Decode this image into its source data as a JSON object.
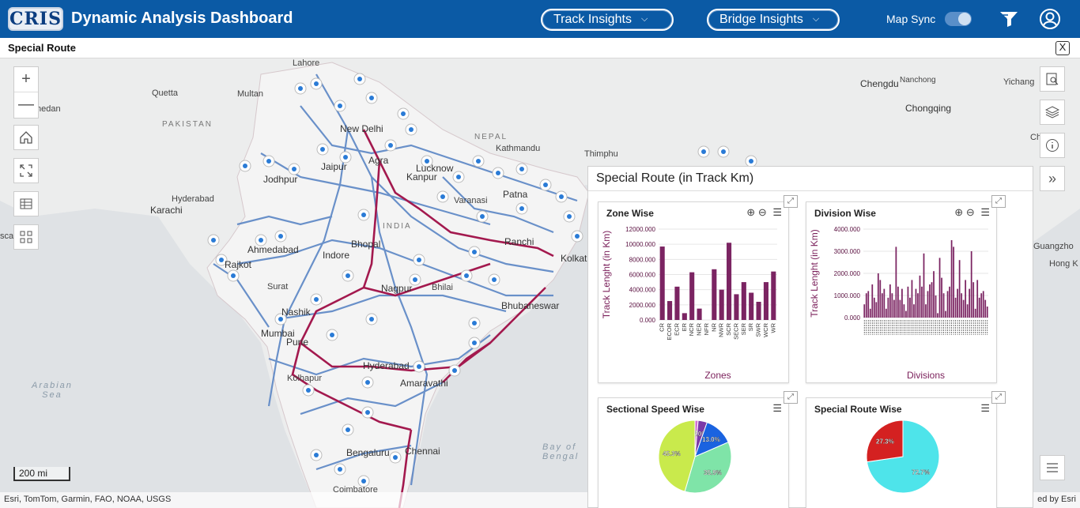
{
  "header": {
    "logo_text": "CRIS",
    "title": "Dynamic Analysis Dashboard",
    "track_insights_label": "Track Insights",
    "bridge_insights_label": "Bridge Insights",
    "map_sync_label": "Map Sync",
    "map_sync_on": true,
    "filter_icon": "filter-icon",
    "user_icon": "user-circle-icon",
    "brand_color": "#0b5aa5"
  },
  "subbar": {
    "title": "Special Route",
    "close_label": "X"
  },
  "map": {
    "labels": {
      "lahore": "Lahore",
      "quetta": "Quetta",
      "multan": "Multan",
      "pakistan": "PAKISTAN",
      "hedan": "hedan",
      "new_delhi": "New Delhi",
      "nepal": "NEPAL",
      "kathmandu": "Kathmandu",
      "thimphu": "Thimphu",
      "chengdu": "Chengdu",
      "nanchong": "Nanchong",
      "yichang": "Yichang",
      "chongqing": "Chongqing",
      "ch": "Ch",
      "jaipur": "Jaipur",
      "agra": "Agra",
      "lucknow": "Lucknow",
      "kanpur": "Kanpur",
      "jodhpur": "Jodhpur",
      "hyderabad_pk": "Hyderabad",
      "karachi": "Karachi",
      "varanasi": "Varanasi",
      "patna": "Patna",
      "india": "INDIA",
      "ranchi": "Ranchi",
      "kolkata": "Kolkat",
      "ahmedabad": "Ahmedabad",
      "rajkot": "Rajkot",
      "bhopal": "Bhopal",
      "indore": "Indore",
      "surat": "Surat",
      "nagpur": "Nagpur",
      "bhilai": "Bhilai",
      "nashik": "Nashik",
      "bhubaneswar": "Bhubaneswar",
      "mumbai": "Mumbai",
      "pune": "Pune",
      "hyderabad": "Hyderabad",
      "kolhapur": "Kolhapur",
      "amaravathi": "Amaravathi",
      "arabian_sea": "Arabian\nSea",
      "bay_of_bengal": "Bay of\nBengal",
      "bengaluru": "Bengaluru",
      "chennai": "Chennai",
      "coimbatore": "Coimbatore",
      "guangzho": "Guangzho",
      "hong": "Hong K",
      "sca": "sca"
    },
    "controls": [
      "zoom-in-icon",
      "zoom-out-icon",
      "home-icon",
      "fullscreen-icon",
      "table-icon",
      "qr-grid-icon"
    ],
    "right_controls": [
      "search-doc-icon",
      "layers-icon",
      "info-icon",
      "double-chevron-right-icon",
      "list-icon"
    ],
    "scale": "200 mi",
    "attribution": "Esri, TomTom, Garmin, FAO, NOAA, USGS",
    "attribution_right": "ed by Esri"
  },
  "panel": {
    "title": "Special Route (in Track Km)",
    "zone_card": {
      "title": "Zone Wise",
      "ylabel": "Track Lenght (in Km)",
      "xlabel": "Zones"
    },
    "division_card": {
      "title": "Division Wise",
      "ylabel": "Track Lenght (in Km)",
      "xlabel": "Divisions"
    },
    "speed_card": {
      "title": "Sectional Speed Wise"
    },
    "special_card": {
      "title": "Special Route Wise"
    }
  },
  "chart_data": [
    {
      "type": "bar",
      "title": "Zone Wise",
      "xlabel": "Zones",
      "ylabel": "Track Lenght (in Km)",
      "categories": [
        "CR",
        "ECOR",
        "ECR",
        "ER",
        "NCR",
        "NER",
        "NFR",
        "NR",
        "NWR",
        "SCR",
        "SECR",
        "SER",
        "SR",
        "SWR",
        "WCR",
        "WR"
      ],
      "values": [
        9700,
        2500,
        4400,
        900,
        6300,
        1500,
        0,
        6700,
        4000,
        10200,
        3400,
        5000,
        3600,
        2400,
        5000,
        6400
      ],
      "yticks": [
        "0.000",
        "2000.000",
        "4000.000",
        "6000.000",
        "8000.000",
        "10000.000",
        "12000.000"
      ],
      "ylim": [
        0,
        12000
      ],
      "color": "#7b2462"
    },
    {
      "type": "bar",
      "title": "Division Wise",
      "xlabel": "Divisions",
      "ylabel": "Track Lenght (in Km)",
      "yticks": [
        "0.000",
        "1000.000",
        "2000.000",
        "3000.000",
        "4000.000"
      ],
      "ylim": [
        0,
        4000
      ],
      "values": [
        600,
        1100,
        1200,
        400,
        1500,
        900,
        700,
        2000,
        1700,
        1100,
        1300,
        400,
        900,
        1500,
        1100,
        800,
        3200,
        1400,
        800,
        1300,
        600,
        300,
        1400,
        900,
        1700,
        600,
        1300,
        1100,
        1900,
        1400,
        2900,
        600,
        1200,
        1500,
        1600,
        2100,
        1000,
        200,
        2700,
        1800,
        1100,
        300,
        1200,
        1400,
        3500,
        3200,
        900,
        1300,
        2600,
        1100,
        800,
        1700,
        600,
        1300,
        3000,
        1600,
        400,
        1700,
        900,
        1100,
        1200,
        800,
        500
      ],
      "color": "#7b2462"
    },
    {
      "type": "pie",
      "title": "Sectional Speed Wise",
      "slices": [
        {
          "label": "1.4%",
          "value": 1.4,
          "color": "#d36fd0"
        },
        {
          "label": "4.0%",
          "value": 4.0,
          "color": "#7b3aa8"
        },
        {
          "label": "13.0%",
          "value": 13.0,
          "color": "#1a63e0"
        },
        {
          "label": "35.9%",
          "value": 35.9,
          "color": "#7fe4a8"
        },
        {
          "label": "45.3%",
          "value": 45.3,
          "color": "#c9ea4c"
        }
      ]
    },
    {
      "type": "pie",
      "title": "Special Route Wise",
      "slices": [
        {
          "label": "72.7%",
          "value": 72.7,
          "color": "#4ee4ea"
        },
        {
          "label": "27.3%",
          "value": 27.3,
          "color": "#d42121"
        }
      ]
    }
  ]
}
